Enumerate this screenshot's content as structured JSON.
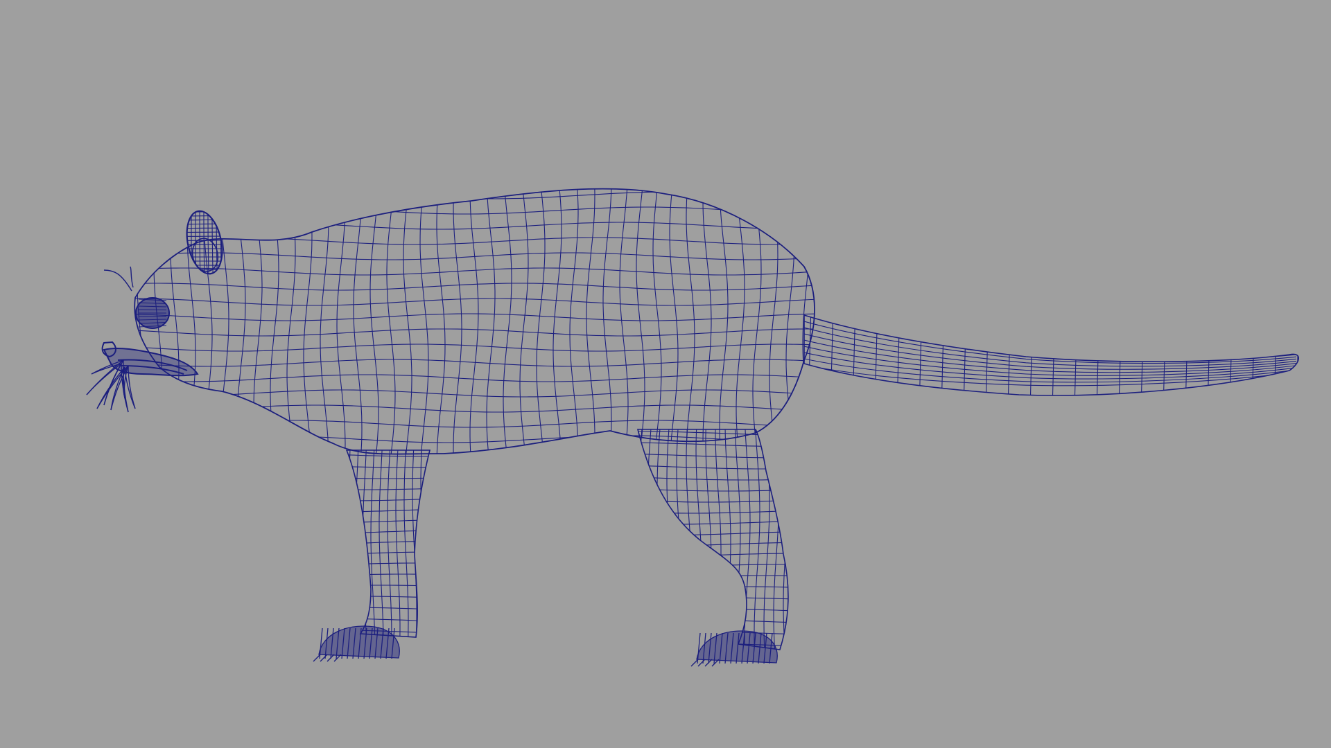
{
  "viewport": {
    "background_color": "#9f9f9f",
    "wireframe_color": "#1c1f7e",
    "shading": "wireframe",
    "subject": "rodent-mesh"
  }
}
